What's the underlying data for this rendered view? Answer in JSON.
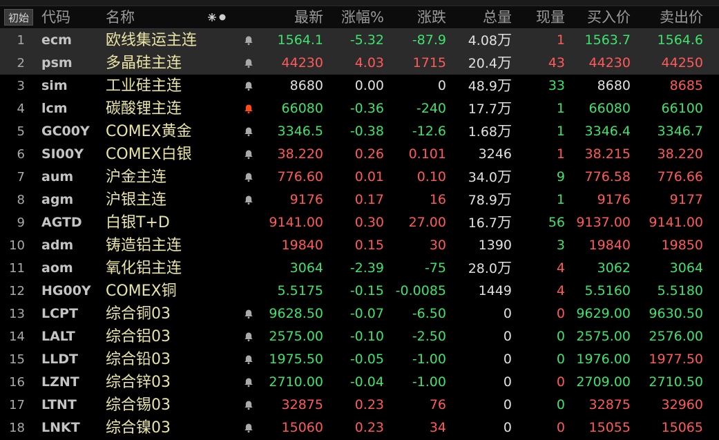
{
  "colors": {
    "up": "#ff5a5a",
    "down": "#3ee36c",
    "flat": "#e0e0e0",
    "name": "#e9e4a5",
    "alert_bell": "#ff4a1a",
    "bell": "#aaaaaa"
  },
  "header": {
    "reset_label": "初始",
    "code": "代码",
    "name": "名称",
    "col_settings_icon": "star-dot-settings-icon",
    "last": "最新",
    "pct": "涨幅%",
    "change": "涨跌",
    "volume": "总量",
    "current_vol": "现量",
    "bid": "买入价",
    "ask": "卖出价"
  },
  "rows": [
    {
      "idx": "1",
      "code": "ecm",
      "name": "欧线集运主连",
      "bell": "normal",
      "last": "1564.1",
      "pct": "-5.32",
      "chg": "-87.9",
      "vol": "4.08",
      "vol_unit": "万",
      "cur": "1",
      "bid": "1563.7",
      "ask": "1564.6",
      "c_last": "down",
      "c_pct": "down",
      "c_chg": "down",
      "c_cur": "up",
      "c_bid": "down",
      "c_ask": "down"
    },
    {
      "idx": "2",
      "code": "psm",
      "name": "多晶硅主连",
      "bell": "normal",
      "last": "44230",
      "pct": "4.03",
      "chg": "1715",
      "vol": "20.4",
      "vol_unit": "万",
      "cur": "43",
      "bid": "44230",
      "ask": "44250",
      "c_last": "up",
      "c_pct": "up",
      "c_chg": "up",
      "c_cur": "up",
      "c_bid": "up",
      "c_ask": "up"
    },
    {
      "idx": "3",
      "code": "sim",
      "name": "工业硅主连",
      "bell": "normal",
      "last": "8680",
      "pct": "0.00",
      "chg": "0",
      "vol": "48.9",
      "vol_unit": "万",
      "cur": "33",
      "bid": "8680",
      "ask": "8685",
      "c_last": "flat",
      "c_pct": "flat",
      "c_chg": "flat",
      "c_cur": "down",
      "c_bid": "flat",
      "c_ask": "up"
    },
    {
      "idx": "4",
      "code": "lcm",
      "name": "碳酸锂主连",
      "bell": "alert",
      "last": "66080",
      "pct": "-0.36",
      "chg": "-240",
      "vol": "17.7",
      "vol_unit": "万",
      "cur": "1",
      "bid": "66080",
      "ask": "66100",
      "c_last": "down",
      "c_pct": "down",
      "c_chg": "down",
      "c_cur": "down",
      "c_bid": "down",
      "c_ask": "down"
    },
    {
      "idx": "5",
      "code": "GC00Y",
      "name": "COMEX黄金",
      "bell": "normal",
      "last": "3346.5",
      "pct": "-0.38",
      "chg": "-12.6",
      "vol": "1.68",
      "vol_unit": "万",
      "cur": "1",
      "bid": "3346.4",
      "ask": "3346.7",
      "c_last": "down",
      "c_pct": "down",
      "c_chg": "down",
      "c_cur": "down",
      "c_bid": "down",
      "c_ask": "down"
    },
    {
      "idx": "6",
      "code": "SI00Y",
      "name": "COMEX白银",
      "bell": "normal",
      "last": "38.220",
      "pct": "0.26",
      "chg": "0.101",
      "vol": "3246",
      "vol_unit": "",
      "cur": "1",
      "bid": "38.215",
      "ask": "38.220",
      "c_last": "up",
      "c_pct": "up",
      "c_chg": "up",
      "c_cur": "up",
      "c_bid": "up",
      "c_ask": "up"
    },
    {
      "idx": "7",
      "code": "aum",
      "name": "沪金主连",
      "bell": "normal",
      "last": "776.60",
      "pct": "0.01",
      "chg": "0.10",
      "vol": "34.0",
      "vol_unit": "万",
      "cur": "9",
      "bid": "776.58",
      "ask": "776.66",
      "c_last": "up",
      "c_pct": "up",
      "c_chg": "up",
      "c_cur": "down",
      "c_bid": "up",
      "c_ask": "up"
    },
    {
      "idx": "8",
      "code": "agm",
      "name": "沪银主连",
      "bell": "normal",
      "last": "9176",
      "pct": "0.17",
      "chg": "16",
      "vol": "78.9",
      "vol_unit": "万",
      "cur": "1",
      "bid": "9176",
      "ask": "9177",
      "c_last": "up",
      "c_pct": "up",
      "c_chg": "up",
      "c_cur": "down",
      "c_bid": "up",
      "c_ask": "up"
    },
    {
      "idx": "9",
      "code": "AGTD",
      "name": "白银T+D",
      "bell": "none",
      "last": "9141.00",
      "pct": "0.30",
      "chg": "27.00",
      "vol": "16.7",
      "vol_unit": "万",
      "cur": "56",
      "bid": "9137.00",
      "ask": "9141.00",
      "c_last": "up",
      "c_pct": "up",
      "c_chg": "up",
      "c_cur": "down",
      "c_bid": "up",
      "c_ask": "up"
    },
    {
      "idx": "10",
      "code": "adm",
      "name": "铸造铝主连",
      "bell": "none",
      "last": "19840",
      "pct": "0.15",
      "chg": "30",
      "vol": "1390",
      "vol_unit": "",
      "cur": "3",
      "bid": "19840",
      "ask": "19850",
      "c_last": "up",
      "c_pct": "up",
      "c_chg": "up",
      "c_cur": "down",
      "c_bid": "up",
      "c_ask": "up"
    },
    {
      "idx": "11",
      "code": "aom",
      "name": "氧化铝主连",
      "bell": "none",
      "last": "3064",
      "pct": "-2.39",
      "chg": "-75",
      "vol": "28.0",
      "vol_unit": "万",
      "cur": "4",
      "bid": "3062",
      "ask": "3064",
      "c_last": "down",
      "c_pct": "down",
      "c_chg": "down",
      "c_cur": "up",
      "c_bid": "down",
      "c_ask": "down"
    },
    {
      "idx": "12",
      "code": "HG00Y",
      "name": "COMEX铜",
      "bell": "none",
      "last": "5.5175",
      "pct": "-0.15",
      "chg": "-0.0085",
      "vol": "1449",
      "vol_unit": "",
      "cur": "4",
      "bid": "5.5160",
      "ask": "5.5180",
      "c_last": "down",
      "c_pct": "down",
      "c_chg": "down",
      "c_cur": "up",
      "c_bid": "down",
      "c_ask": "down"
    },
    {
      "idx": "13",
      "code": "LCPT",
      "name": "综合铜03",
      "bell": "normal",
      "last": "9628.50",
      "pct": "-0.07",
      "chg": "-6.50",
      "vol": "0",
      "vol_unit": "",
      "cur": "0",
      "bid": "9629.00",
      "ask": "9630.50",
      "c_last": "down",
      "c_pct": "down",
      "c_chg": "down",
      "c_cur": "up",
      "c_bid": "down",
      "c_ask": "down"
    },
    {
      "idx": "14",
      "code": "LALT",
      "name": "综合铝03",
      "bell": "normal",
      "last": "2575.00",
      "pct": "-0.10",
      "chg": "-2.50",
      "vol": "0",
      "vol_unit": "",
      "cur": "0",
      "bid": "2575.00",
      "ask": "2576.00",
      "c_last": "down",
      "c_pct": "down",
      "c_chg": "down",
      "c_cur": "down",
      "c_bid": "down",
      "c_ask": "down"
    },
    {
      "idx": "15",
      "code": "LLDT",
      "name": "综合铅03",
      "bell": "normal",
      "last": "1975.50",
      "pct": "-0.05",
      "chg": "-1.00",
      "vol": "0",
      "vol_unit": "",
      "cur": "0",
      "bid": "1976.00",
      "ask": "1977.50",
      "c_last": "down",
      "c_pct": "down",
      "c_chg": "down",
      "c_cur": "down",
      "c_bid": "down",
      "c_ask": "up"
    },
    {
      "idx": "16",
      "code": "LZNT",
      "name": "综合锌03",
      "bell": "normal",
      "last": "2710.00",
      "pct": "-0.04",
      "chg": "-1.00",
      "vol": "0",
      "vol_unit": "",
      "cur": "0",
      "bid": "2709.00",
      "ask": "2710.50",
      "c_last": "down",
      "c_pct": "down",
      "c_chg": "down",
      "c_cur": "up",
      "c_bid": "down",
      "c_ask": "down"
    },
    {
      "idx": "17",
      "code": "LTNT",
      "name": "综合锡03",
      "bell": "normal",
      "last": "32875",
      "pct": "0.23",
      "chg": "76",
      "vol": "0",
      "vol_unit": "",
      "cur": "0",
      "bid": "32875",
      "ask": "32960",
      "c_last": "up",
      "c_pct": "up",
      "c_chg": "up",
      "c_cur": "down",
      "c_bid": "up",
      "c_ask": "up"
    },
    {
      "idx": "18",
      "code": "LNKT",
      "name": "综合镍03",
      "bell": "normal",
      "last": "15060",
      "pct": "0.23",
      "chg": "34",
      "vol": "0",
      "vol_unit": "",
      "cur": "0",
      "bid": "15055",
      "ask": "15065",
      "c_last": "up",
      "c_pct": "up",
      "c_chg": "up",
      "c_cur": "up",
      "c_bid": "up",
      "c_ask": "up"
    }
  ]
}
